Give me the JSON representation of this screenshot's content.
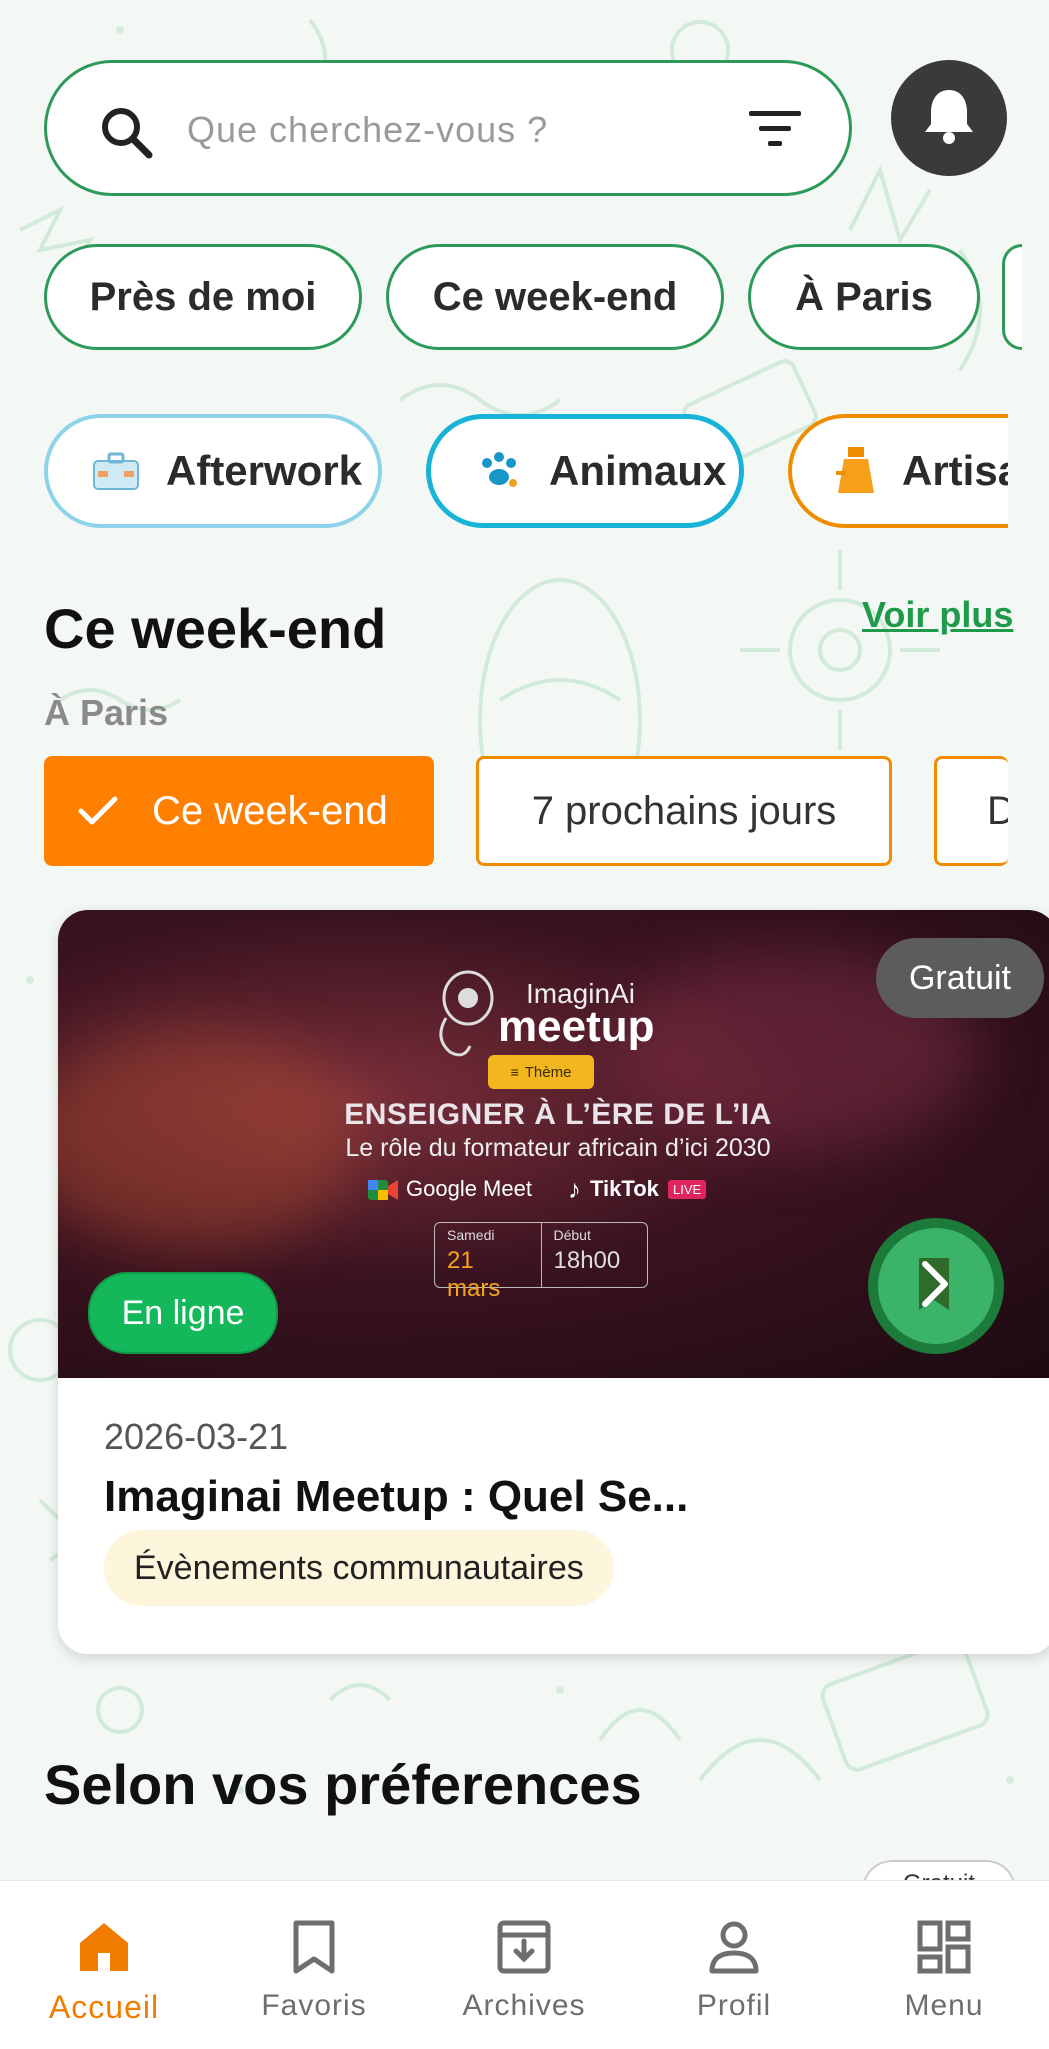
{
  "search": {
    "placeholder": "Que cherchez-vous ?"
  },
  "quick_filters": [
    {
      "label": "Près de moi"
    },
    {
      "label": "Ce week-end"
    },
    {
      "label": "À Paris"
    }
  ],
  "categories": [
    {
      "label": "Afterwork",
      "color": "#8fd3ea",
      "icon": "briefcase-icon"
    },
    {
      "label": "Animaux",
      "color": "#18b4d8",
      "icon": "paw-icon"
    },
    {
      "label": "Artisa",
      "color": "#f08c00",
      "icon": "vase-icon"
    }
  ],
  "weekend_section": {
    "title": "Ce week-end",
    "more_link": "Voir plus",
    "subtitle": "À Paris",
    "periods": [
      {
        "label": "Ce week-end",
        "selected": true
      },
      {
        "label": "7 prochains jours",
        "selected": false
      },
      {
        "label": "D",
        "selected": false
      }
    ]
  },
  "event_card": {
    "price_badge": "Gratuit",
    "mode_badge": "En ligne",
    "poster": {
      "brand_small": "ImaginAi",
      "brand_big": "meetup",
      "theme_label": "Thème",
      "headline": "ENSEIGNER À L’ÈRE DE L’IA",
      "subheadline": "Le rôle du formateur africain d’ici 2030",
      "platform_1": "Google Meet",
      "platform_2": "TikTok",
      "platform_2_badge": "LIVE",
      "day_label": "Samedi",
      "day_value": "21 mars",
      "time_label": "Début",
      "time_value": "18h00"
    },
    "date": "2026-03-21",
    "title": "Imaginai Meetup : Quel Se...",
    "category": "Évènements communautaires"
  },
  "preferences_section": {
    "title": "Selon vos préferences",
    "partial_badge": "Gratuit"
  },
  "bottom_nav": [
    {
      "label": "Accueil",
      "icon": "home-icon",
      "active": true
    },
    {
      "label": "Favoris",
      "icon": "bookmark-icon",
      "active": false
    },
    {
      "label": "Archives",
      "icon": "archive-icon",
      "active": false
    },
    {
      "label": "Profil",
      "icon": "person-icon",
      "active": false
    },
    {
      "label": "Menu",
      "icon": "dashboard-icon",
      "active": false
    }
  ],
  "colors": {
    "brand_green": "#2e9a5a",
    "accent_orange": "#f07d00",
    "link_green": "#1f9a4a"
  }
}
